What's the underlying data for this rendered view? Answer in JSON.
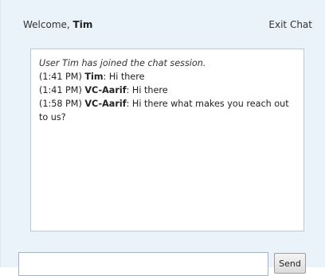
{
  "header": {
    "welcome_prefix": "Welcome, ",
    "user_name": "Tim",
    "exit_label": "Exit Chat"
  },
  "transcript": {
    "system_message": "User Tim has joined the chat session.",
    "messages": [
      {
        "time": "(1:41 PM) ",
        "sender": "Tim",
        "text": ": Hi there"
      },
      {
        "time": "(1:41 PM) ",
        "sender": "VC-Aarif",
        "text": ": Hi there"
      },
      {
        "time": "(1:58 PM) ",
        "sender": "VC-Aarif",
        "text": ": Hi there what makes you reach out to us?"
      }
    ]
  },
  "composer": {
    "input_value": "",
    "send_label": "Send"
  },
  "colors": {
    "panel_background": "#eaf2fa",
    "transcript_border": "#b9cadd"
  }
}
